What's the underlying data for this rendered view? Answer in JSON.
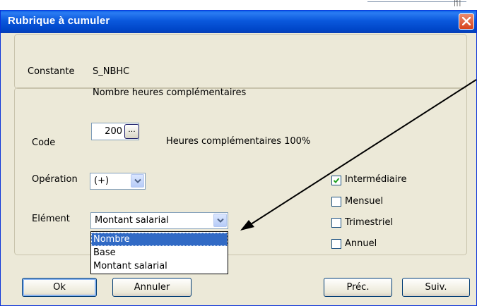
{
  "background": {
    "corner_text": "|'| |"
  },
  "dialog": {
    "title": "Rubrique à cumuler",
    "close_icon": "close-icon"
  },
  "constant": {
    "label": "Constante",
    "code": "S_NBHC",
    "description": "Nombre heures complémentaires"
  },
  "code_field": {
    "label": "Code",
    "value": "200",
    "browse_label": "...",
    "description": "Heures complémentaires 100%"
  },
  "operation": {
    "label": "Opération",
    "selected": "(+)"
  },
  "element": {
    "label": "Elément",
    "selected": "Montant salarial",
    "options": [
      "Nombre",
      "Base",
      "Montant salarial"
    ],
    "highlighted_index": 0
  },
  "periods": [
    {
      "label": "Intermédiaire",
      "checked": true
    },
    {
      "label": "Mensuel",
      "checked": false
    },
    {
      "label": "Trimestriel",
      "checked": false
    },
    {
      "label": "Annuel",
      "checked": false
    }
  ],
  "buttons": {
    "ok": "Ok",
    "cancel": "Annuler",
    "prev": "Préc.",
    "next": "Suiv."
  },
  "colors": {
    "titlebar": "#0a58dc",
    "dialog_bg": "#ece9d8",
    "selection": "#316ac5",
    "check": "#21a121"
  }
}
